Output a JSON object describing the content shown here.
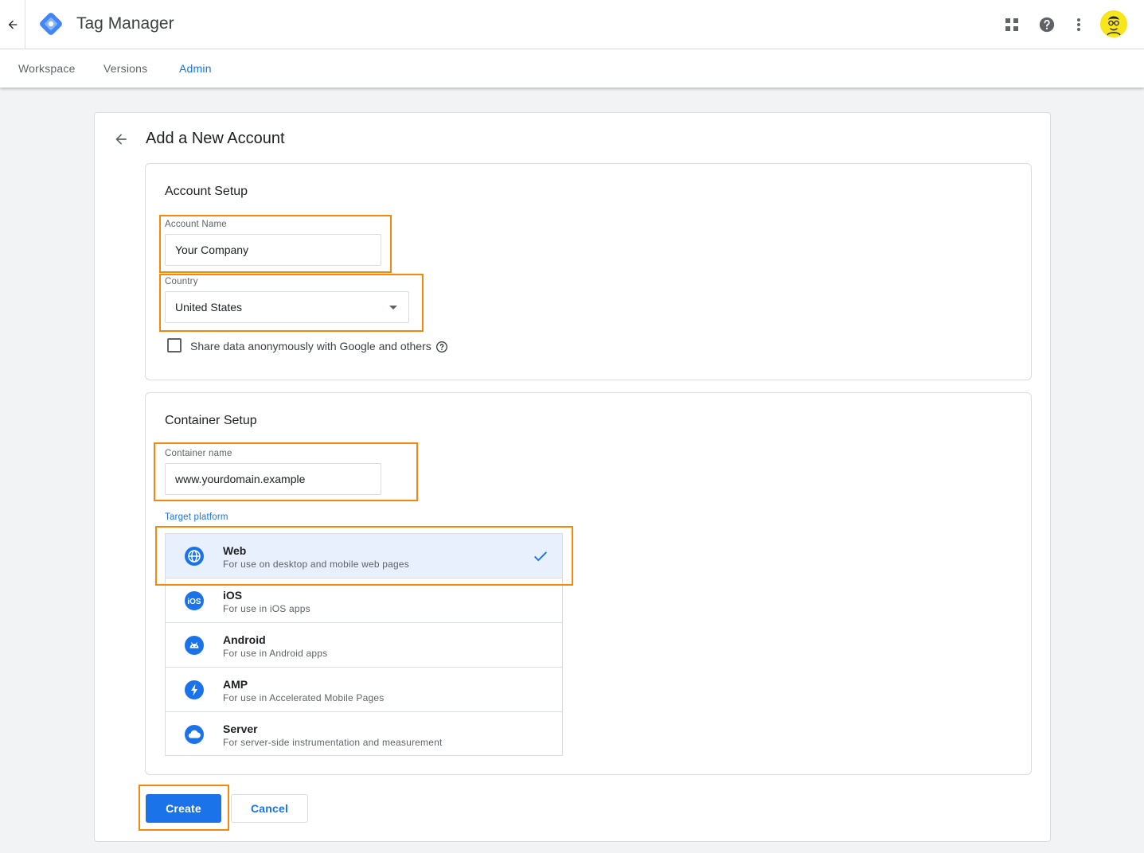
{
  "app": {
    "title": "Tag Manager"
  },
  "nav": {
    "tabs": [
      {
        "label": "Workspace"
      },
      {
        "label": "Versions"
      },
      {
        "label": "Admin"
      }
    ]
  },
  "page": {
    "title": "Add a New Account"
  },
  "account_setup": {
    "title": "Account Setup",
    "account_name_label": "Account Name",
    "account_name_value": "Your Company",
    "country_label": "Country",
    "country_value": "United States",
    "share_data_label": "Share data anonymously with Google and others",
    "share_data_checked": false
  },
  "container_setup": {
    "title": "Container Setup",
    "container_name_label": "Container name",
    "container_name_value": "www.yourdomain.example",
    "target_platform_label": "Target platform",
    "platforms": [
      {
        "name": "Web",
        "description": "For use on desktop and mobile web pages",
        "icon": "globe-icon",
        "selected": true
      },
      {
        "name": "iOS",
        "description": "For use in iOS apps",
        "icon": "ios-icon",
        "selected": false
      },
      {
        "name": "Android",
        "description": "For use in Android apps",
        "icon": "android-icon",
        "selected": false
      },
      {
        "name": "AMP",
        "description": "For use in Accelerated Mobile Pages",
        "icon": "amp-lightning-icon",
        "selected": false
      },
      {
        "name": "Server",
        "description": "For server-side instrumentation and measurement",
        "icon": "cloud-icon",
        "selected": false
      }
    ]
  },
  "actions": {
    "create_label": "Create",
    "cancel_label": "Cancel"
  },
  "colors": {
    "accent": "#1a73e8",
    "highlight": "#f5870a",
    "selected_row": "#e8f0fe"
  }
}
